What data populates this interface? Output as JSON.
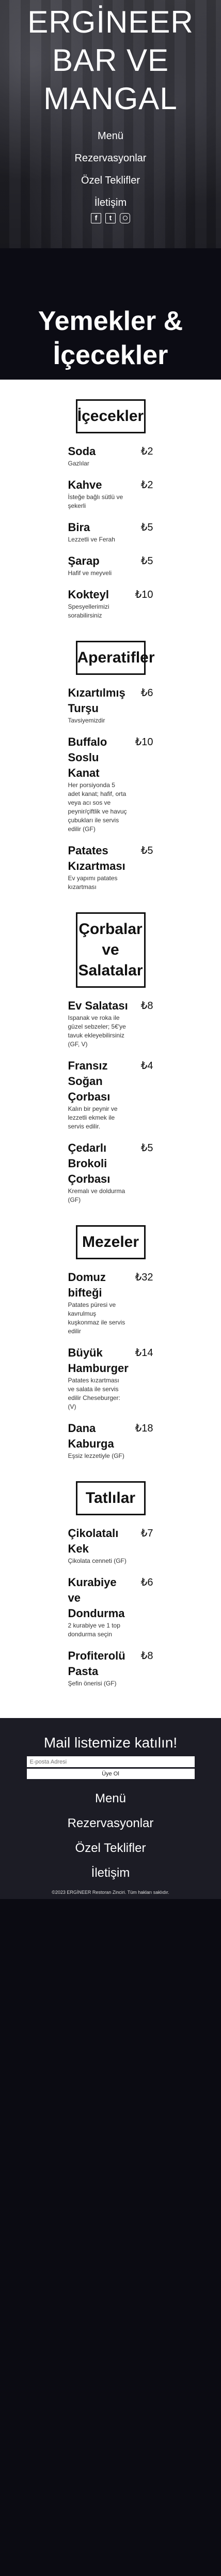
{
  "hero": {
    "brand": "ERGİNEER BAR VE MANGAL",
    "nav": [
      "Menü",
      "Rezervasyonlar",
      "Özel Teklifler",
      "İletişim"
    ],
    "socials": [
      {
        "icon": "facebook-icon",
        "glyph": "f"
      },
      {
        "icon": "twitter-icon",
        "glyph": "t"
      },
      {
        "icon": "instagram-icon",
        "glyph": ""
      }
    ]
  },
  "menu_title": "Yemekler & İçecekler",
  "sections": [
    {
      "title": "İçecekler",
      "items": [
        {
          "name": "Soda",
          "price": "₺2",
          "desc": "Gazlılar"
        },
        {
          "name": "Kahve",
          "price": "₺2",
          "desc": "İsteğe bağlı sütlü ve şekerli"
        },
        {
          "name": "Bira",
          "price": "₺5",
          "desc": "Lezzetli ve Ferah"
        },
        {
          "name": "Şarap",
          "price": "₺5",
          "desc": "Hafif ve meyveli"
        },
        {
          "name": "Kokteyl",
          "price": "₺10",
          "desc": "Spesyellerimizi sorabilirsiniz"
        }
      ]
    },
    {
      "title": "Aperatifler",
      "items": [
        {
          "name": "Kızartılmış Turşu",
          "price": "₺6",
          "desc": "Tavsiyemizdir"
        },
        {
          "name": "Buffalo Soslu Kanat",
          "price": "₺10",
          "desc": "Her porsiyonda 5 adet kanat; hafif, orta veya acı sos ve peynir/çiftlik ve havuç çubukları ile servis edilir (GF)"
        },
        {
          "name": "Patates Kızartması",
          "price": "₺5",
          "desc": "Ev yapımı patates kızartması"
        }
      ]
    },
    {
      "title": "Çorbalar ve Salatalar",
      "items": [
        {
          "name": "Ev Salatası",
          "price": "₺8",
          "desc": "Ispanak ve roka ile güzel sebzeler; 5€'ye tavuk ekleyebilirsiniz (GF, V)"
        },
        {
          "name": "Fransız Soğan Çorbası",
          "price": "₺4",
          "desc": "Kalın bir peynir ve lezzetli ekmek ile servis edilir."
        },
        {
          "name": "Çedarlı Brokoli Çorbası",
          "price": "₺5",
          "desc": "Kremalı ve doldurma (GF)"
        }
      ]
    },
    {
      "title": "Mezeler",
      "items": [
        {
          "name": "Domuz bifteği",
          "price": "₺32",
          "desc": "Patates püresi ve kavrulmuş kuşkonmaz ile servis edilir"
        },
        {
          "name": "Büyük Hamburger",
          "price": "₺14",
          "desc": "Patates kızartması ve salata ile servis edilir Cheseburger: (V)"
        },
        {
          "name": "Dana Kaburga",
          "price": "₺18",
          "desc": "Eşsiz lezzetiyle (GF)"
        }
      ]
    },
    {
      "title": "Tatlılar",
      "items": [
        {
          "name": "Çikolatalı Kek",
          "price": "₺7",
          "desc": "Çikolata cenneti (GF)"
        },
        {
          "name": "Kurabiye ve Dondurma",
          "price": "₺6",
          "desc": "2 kurabiye ve 1 top dondurma seçin"
        },
        {
          "name": "Profiterolü Pasta",
          "price": "₺8",
          "desc": "Şefin önerisi (GF)"
        }
      ]
    }
  ],
  "footer": {
    "signup_title": "Mail listemize katılın!",
    "email_placeholder": "E-posta Adresi",
    "submit_label": "Üye Ol",
    "nav": [
      "Menü",
      "Rezervasyonlar",
      "Özel Teklifler",
      "İletişim"
    ],
    "copyright": "©2023 ERGİNEER Restoran Zinciri. Tüm hakları saklıdır."
  }
}
